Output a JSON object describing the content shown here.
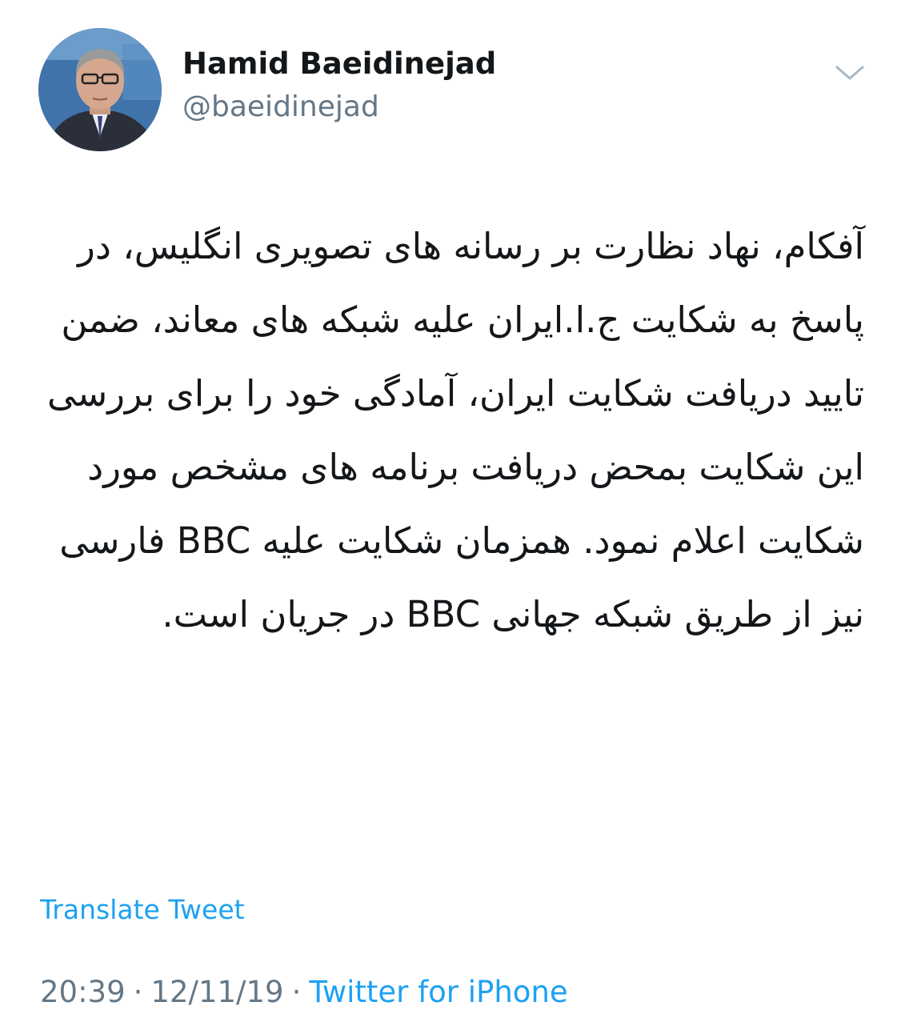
{
  "user": {
    "display_name": "Hamid Baeidinejad",
    "handle": "@baeidinejad"
  },
  "tweet": {
    "text": "آفکام، نهاد نظارت بر رسانه های تصویری انگلیس، در پاسخ به شکایت ج.ا.ایران علیه شبکه های معاند، ضمن تایید دریافت شکایت ایران، آمادگی خود را برای بررسی این شکایت بمحض دریافت برنامه های مشخص مورد شکایت اعلام نمود. همزمان شکایت علیه BBC فارسی نیز از طریق شبکه جهانی BBC در جریان است."
  },
  "actions": {
    "translate_label": "Translate Tweet"
  },
  "meta": {
    "time": "20:39",
    "separator": "·",
    "date": "12/11/19",
    "source": "Twitter for iPhone"
  },
  "icons": {
    "caret": "chevron-down-icon"
  },
  "colors": {
    "link": "#1da1f2",
    "secondary_text": "#657786",
    "primary_text": "#14171a"
  }
}
